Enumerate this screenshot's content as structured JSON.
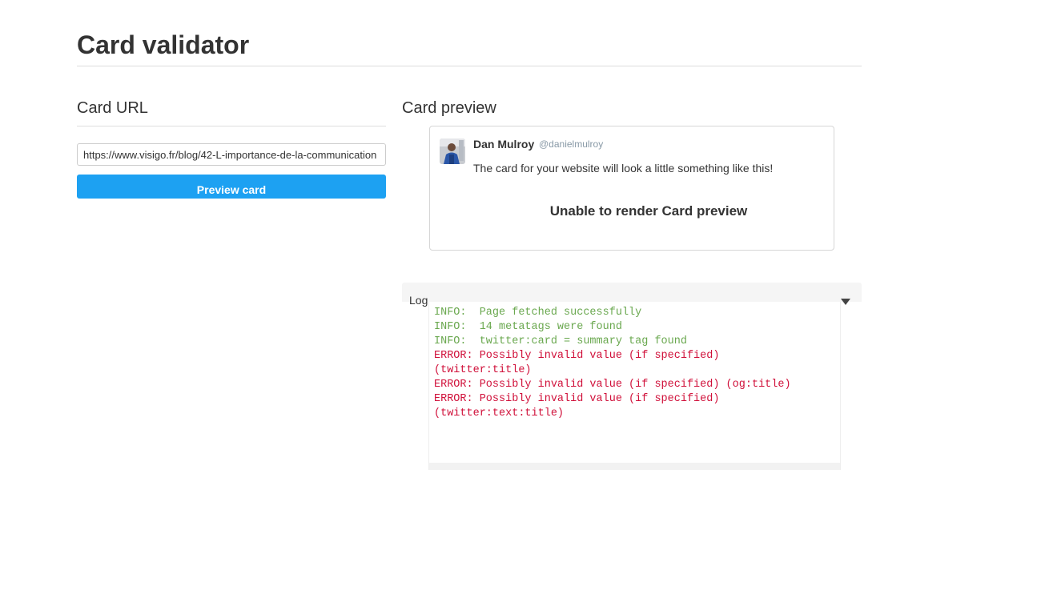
{
  "page": {
    "title": "Card validator"
  },
  "url_section": {
    "heading": "Card URL",
    "url_value": "https://www.visigo.fr/blog/42-L-importance-de-la-communication",
    "button_label": "Preview card"
  },
  "preview_section": {
    "heading": "Card preview",
    "author_name": "Dan Mulroy",
    "author_handle": "@danielmulroy",
    "tweet_text": "The card for your website will look a little something like this!",
    "render_error": "Unable to render Card preview"
  },
  "log": {
    "label": "Log",
    "lines": [
      {
        "type": "info",
        "text": "INFO:  Page fetched successfully"
      },
      {
        "type": "info",
        "text": "INFO:  14 metatags were found"
      },
      {
        "type": "info",
        "text": "INFO:  twitter:card = summary tag found"
      },
      {
        "type": "error",
        "text": "ERROR: Possibly invalid value (if specified)"
      },
      {
        "type": "error",
        "text": "(twitter:title)"
      },
      {
        "type": "error",
        "text": "ERROR: Possibly invalid value (if specified) (og:title)"
      },
      {
        "type": "error",
        "text": "ERROR: Possibly invalid value (if specified)"
      },
      {
        "type": "error",
        "text": "(twitter:text:title)"
      }
    ]
  },
  "colors": {
    "primary_button": "#1da1f2",
    "log_info": "#6aa84f",
    "log_error": "#d0103a"
  }
}
